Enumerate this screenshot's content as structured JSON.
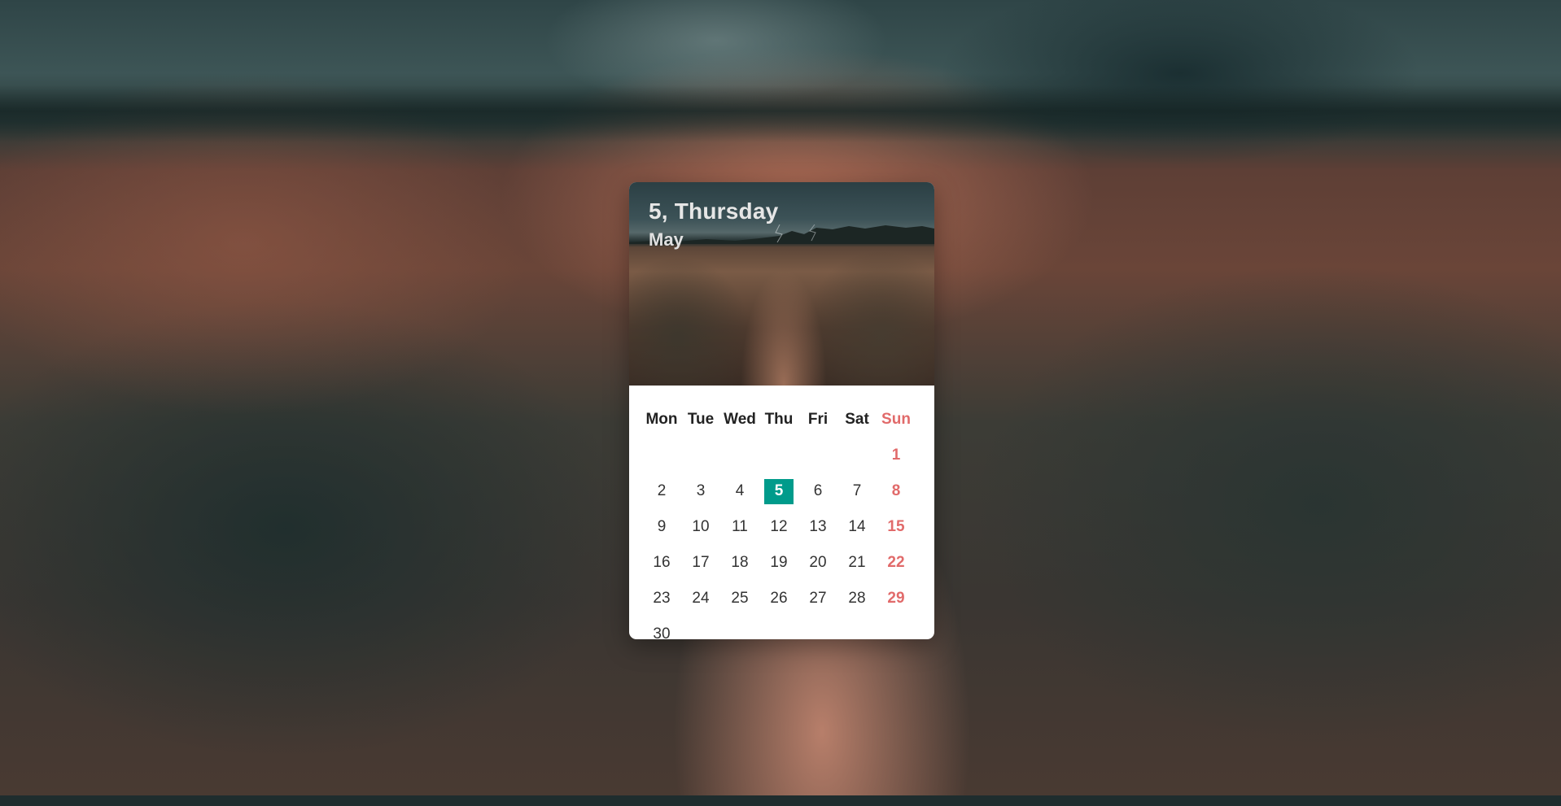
{
  "header": {
    "day_title": "5, Thursday",
    "month": "May"
  },
  "weekdays": [
    "Mon",
    "Tue",
    "Wed",
    "Thu",
    "Fri",
    "Sat",
    "Sun"
  ],
  "weeks": [
    [
      "",
      "",
      "",
      "",
      "",
      "",
      "1"
    ],
    [
      "2",
      "3",
      "4",
      "5",
      "6",
      "7",
      "8"
    ],
    [
      "9",
      "10",
      "11",
      "12",
      "13",
      "14",
      "15"
    ],
    [
      "16",
      "17",
      "18",
      "19",
      "20",
      "21",
      "22"
    ],
    [
      "23",
      "24",
      "25",
      "26",
      "27",
      "28",
      "29"
    ],
    [
      "30",
      "",
      "",
      "",
      "",
      "",
      ""
    ]
  ],
  "today": "5",
  "colors": {
    "today_bg": "#009b8b",
    "sunday": "#e16a6a",
    "text": "#333333"
  }
}
